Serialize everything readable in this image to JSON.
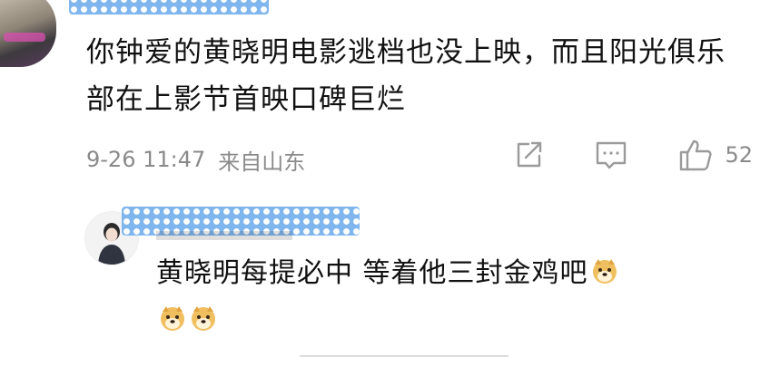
{
  "comment": {
    "text": "你钟爱的黄晓明电影逃档也没上映，而且阳光俱乐部在上影节首映口碑巨烂",
    "time": "9-26 11:47",
    "location": "来自山东",
    "like_count": "52"
  },
  "reply": {
    "text": "黄晓明每提必中  等着他三封金鸡吧"
  },
  "colors": {
    "mask": "#7fb6ee",
    "meta_text": "#8a8a8a"
  },
  "icons": [
    "share-icon",
    "comment-icon",
    "like-icon",
    "doge-emoji"
  ]
}
